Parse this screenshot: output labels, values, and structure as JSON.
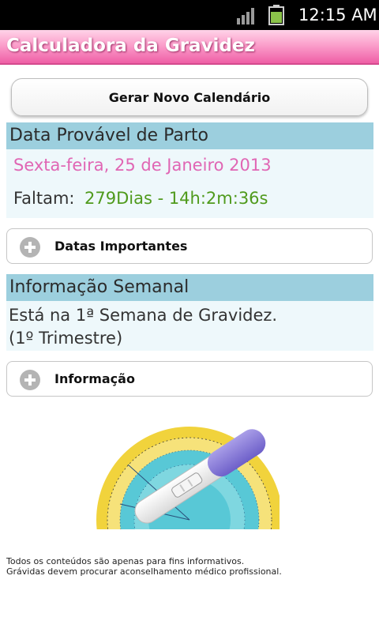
{
  "status_bar": {
    "time": "12:15 AM",
    "signal_icon": "signal-bars-icon",
    "battery_icon": "battery-icon",
    "battery_color": "#8bc34a"
  },
  "app": {
    "title": "Calculadora da Gravidez",
    "title_bar_color": "#f37bb7"
  },
  "actions": {
    "generate_label": "Gerar Novo Calendário"
  },
  "due_date": {
    "header": "Data Provável de Parto",
    "date_text": "Sexta-feira, 25 de Janeiro 2013",
    "remaining_label": "Faltam:",
    "remaining_value": "279Dias - 14h:2m:36s"
  },
  "important_dates": {
    "label": "Datas Importantes",
    "icon": "expand-plus-icon"
  },
  "weekly_info": {
    "header": "Informação Semanal",
    "line1": "Está na 1ª Semana de Gravidez.",
    "line2": "(1º Trimestre)"
  },
  "information": {
    "label": "Informação",
    "icon": "expand-plus-icon"
  },
  "illustration": {
    "icon": "pregnancy-test-calendar-wheel-image"
  },
  "disclaimer": {
    "line1": "Todos os conteúdos são apenas para fins informativos.",
    "line2": "Grávidas devem procurar aconselhamento médico profissional."
  },
  "colors": {
    "section_header": "#9ccfde",
    "section_body": "#eef8fb",
    "date_text": "#e066b4",
    "remaining_value": "#4f9a1c"
  }
}
